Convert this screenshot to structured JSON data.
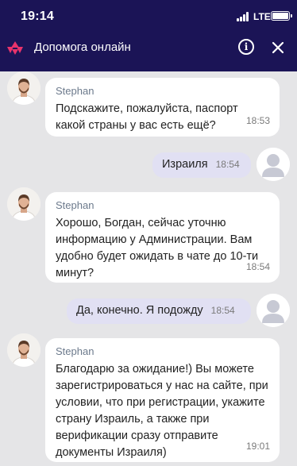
{
  "status_bar": {
    "time": "19:14",
    "network": "LTE"
  },
  "header": {
    "title": "Допомога онлайн",
    "info_icon": "info-icon",
    "close_icon": "close-icon",
    "logo_icon": "brand-logo-icon",
    "background_color": "#1b1456",
    "accent_color": "#e8336b"
  },
  "messages": [
    {
      "from": "agent",
      "sender": "Stephan",
      "text": "Подскажите, пожалуйста, паспорт какой страны у вас есть ещё?",
      "time": "18:53"
    },
    {
      "from": "user",
      "text": "Израиля",
      "time": "18:54"
    },
    {
      "from": "agent",
      "sender": "Stephan",
      "text": "Хорошо, Богдан, сейчас уточню информацию у Администрации. Вам удобно будет ожидать в чате до 10-ти минут?",
      "time": "18:54"
    },
    {
      "from": "user",
      "text": "Да, конечно. Я подожду",
      "time": "18:54"
    },
    {
      "from": "agent",
      "sender": "Stephan",
      "text": "Благодарю за ожидание!) Вы можете зарегистрироваться у нас на сайте, при условии, что при регистрации, укажите страну Израиль, а также при верификации сразу отправите документы Израиля)",
      "time": "19:01"
    }
  ]
}
